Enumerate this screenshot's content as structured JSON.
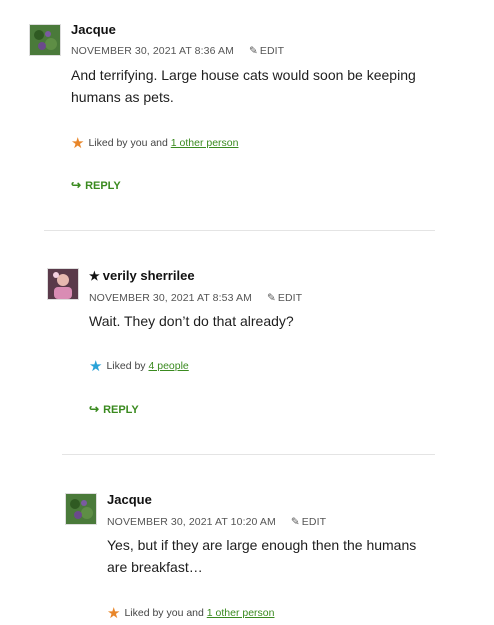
{
  "comments": [
    {
      "author": "Jacque",
      "timestamp": "NOVEMBER 30, 2021 AT 8:36 AM",
      "edit": "EDIT",
      "text": "And terrifying. Large house cats would soon be keeping humans as pets.",
      "likes_prefix": "Liked by you and ",
      "likes_link": "1 other person",
      "likes_star_color": "#e8862a",
      "reply": "REPLY"
    },
    {
      "author_star": "★",
      "author": "verily sherrilee",
      "timestamp": "NOVEMBER 30, 2021 AT 8:53 AM",
      "edit": "EDIT",
      "text": "Wait. They don’t do that already?",
      "likes_prefix": "Liked by ",
      "likes_link": "4 people",
      "likes_star_color": "#2aa3d8",
      "reply": "REPLY"
    },
    {
      "author": "Jacque",
      "timestamp": "NOVEMBER 30, 2021 AT 10:20 AM",
      "edit": "EDIT",
      "text": "Yes, but if they are large enough then the humans are breakfast…",
      "likes_prefix": "Liked by you and ",
      "likes_link": "1 other person",
      "likes_star_color": "#e8862a"
    }
  ],
  "colors": {
    "link": "#3a8a1f",
    "divider": "#e4e4e4"
  },
  "icons": {
    "edit": "pencil-icon",
    "reply": "reply-arrow-icon",
    "like": "star-icon"
  }
}
